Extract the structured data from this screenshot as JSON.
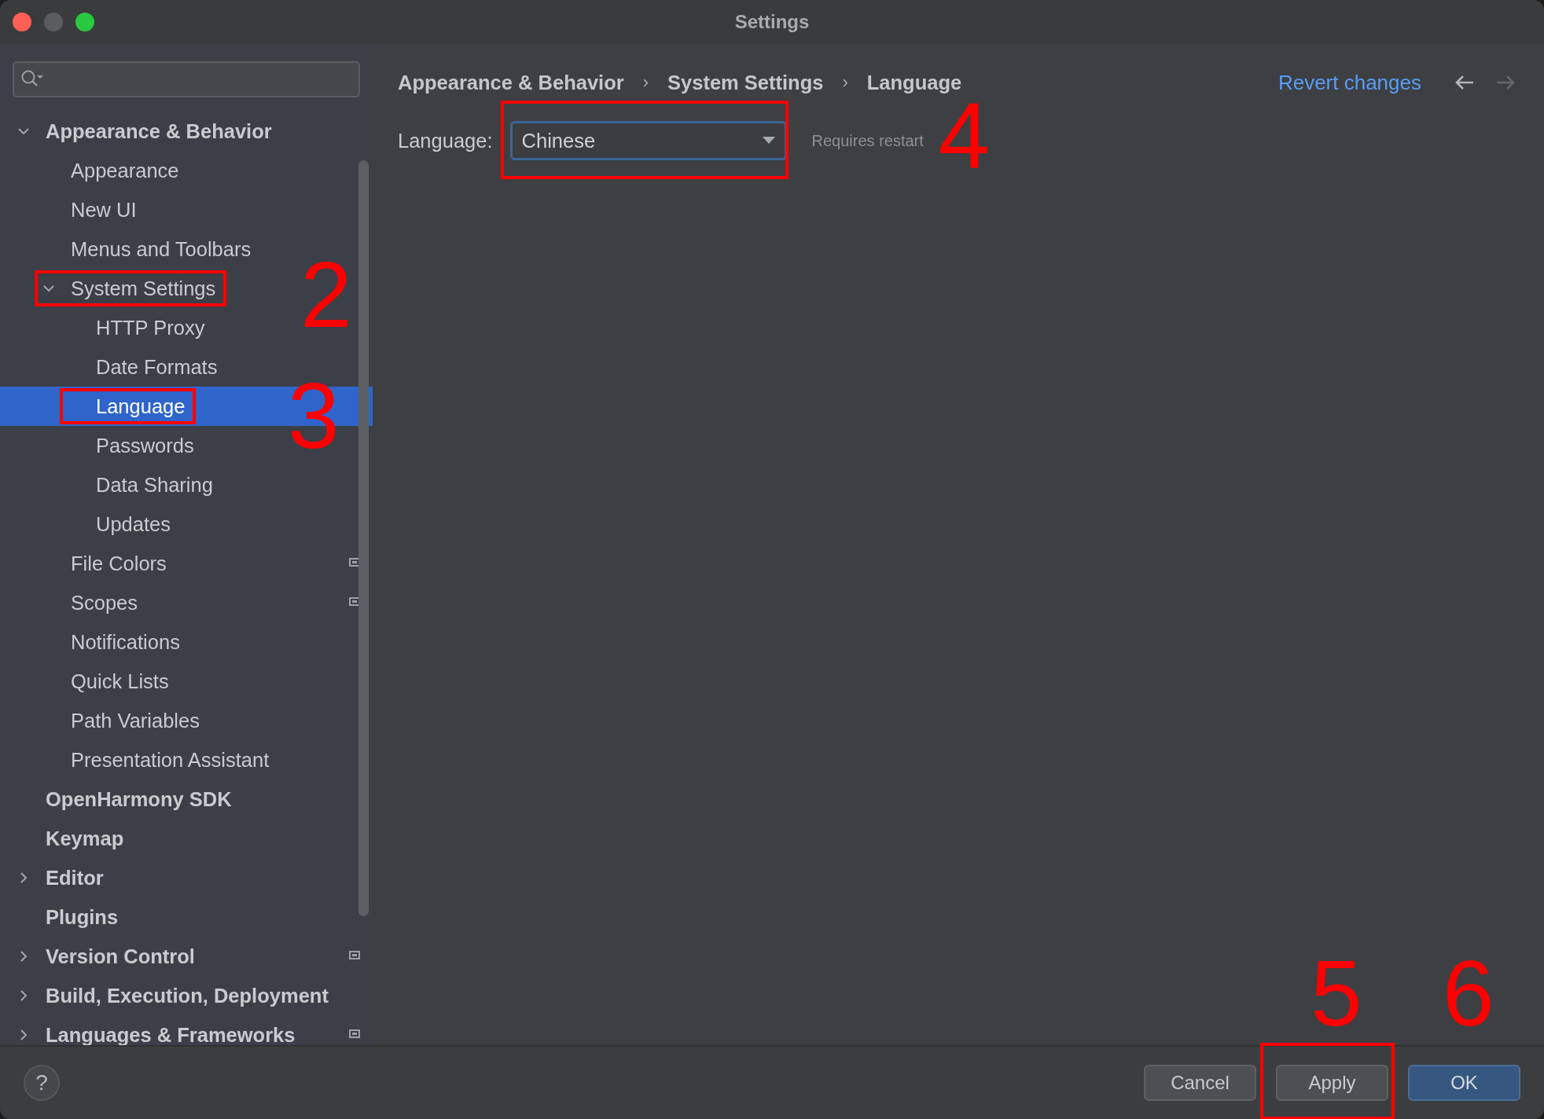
{
  "window": {
    "title": "Settings"
  },
  "tree": [
    {
      "label": "Appearance & Behavior",
      "expanded": true,
      "selected": false,
      "children": [
        {
          "label": "Appearance",
          "selected": false
        },
        {
          "label": "New UI",
          "selected": false
        },
        {
          "label": "Menus and Toolbars",
          "selected": false
        },
        {
          "label": "System Settings",
          "expanded": true,
          "selected": false,
          "annotation": {
            "number": "2",
            "boxed": true
          },
          "children": [
            {
              "label": "HTTP Proxy",
              "selected": false
            },
            {
              "label": "Date Formats",
              "selected": false
            },
            {
              "label": "Language",
              "selected": true,
              "annotation": {
                "number": "3",
                "boxed": true
              }
            },
            {
              "label": "Passwords",
              "selected": false
            },
            {
              "label": "Data Sharing",
              "selected": false
            },
            {
              "label": "Updates",
              "selected": false
            }
          ]
        },
        {
          "label": "File Colors",
          "selected": false,
          "scope_icon": true
        },
        {
          "label": "Scopes",
          "selected": false,
          "scope_icon": true
        },
        {
          "label": "Notifications",
          "selected": false
        },
        {
          "label": "Quick Lists",
          "selected": false
        },
        {
          "label": "Path Variables",
          "selected": false
        },
        {
          "label": "Presentation Assistant",
          "selected": false
        }
      ]
    },
    {
      "label": "OpenHarmony SDK",
      "selected": false
    },
    {
      "label": "Keymap",
      "selected": false
    },
    {
      "label": "Editor",
      "expanded": false,
      "selected": false
    },
    {
      "label": "Plugins",
      "selected": false
    },
    {
      "label": "Version Control",
      "expanded": false,
      "selected": false,
      "scope_icon": true
    },
    {
      "label": "Build, Execution, Deployment",
      "expanded": false,
      "selected": false
    },
    {
      "label": "Languages & Frameworks",
      "expanded": false,
      "selected": false,
      "scope_icon": true
    }
  ],
  "breadcrumb": [
    "Appearance & Behavior",
    "System Settings",
    "Language"
  ],
  "breadcrumb_separator": "›",
  "revert_link": "Revert changes",
  "language_field": {
    "label": "Language:",
    "value": "Chinese",
    "note": "Requires restart",
    "annotation": {
      "number": "4",
      "boxed": true
    }
  },
  "buttons": [
    {
      "label": "Cancel",
      "kind": "normal"
    },
    {
      "label": "Apply",
      "kind": "normal",
      "annotation": {
        "number": "5",
        "boxed": true
      }
    },
    {
      "label": "OK",
      "kind": "default",
      "annotation": {
        "number": "6"
      }
    }
  ],
  "help": "?"
}
